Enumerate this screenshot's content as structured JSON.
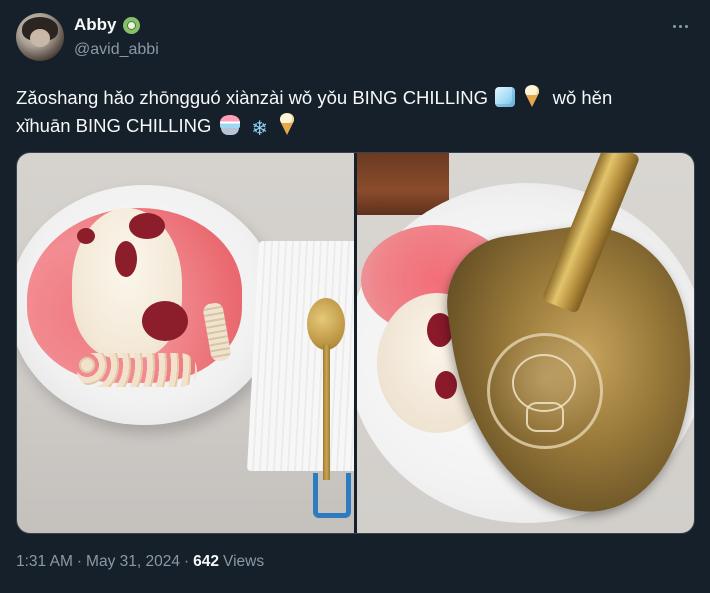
{
  "author": {
    "display_name": "Abby",
    "handle": "@avid_abbi",
    "badge_icon": "kiwi-badge-icon"
  },
  "tweet": {
    "text_line1_prefix": "Zǎoshang hǎo zhōngguó xiànzài wǒ yǒu BING CHILLING",
    "text_line1_suffix": "wǒ hěn",
    "text_line2_prefix": "xǐhuān BING CHILLING",
    "emojis": [
      "ice-cube-icon",
      "soft-ice-cream-icon",
      "shaved-ice-icon",
      "snowflake-icon",
      "soft-ice-cream-icon"
    ],
    "snowflake_glyph": "❄"
  },
  "meta": {
    "time": "1:31 AM",
    "separator": "·",
    "date": "May 31, 2024",
    "views_count": "642",
    "views_label": "Views"
  },
  "colors": {
    "background": "#15202b",
    "primary_text": "#f7f9f9",
    "secondary_text": "#8b98a5",
    "border": "#38444d"
  }
}
